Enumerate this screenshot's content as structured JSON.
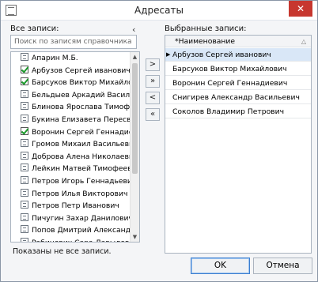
{
  "window": {
    "title": "Адресаты",
    "close_label": "✕"
  },
  "left": {
    "label": "Все записи:",
    "search_placeholder": "Поиск по записям справочника \"Работ...",
    "collapse_glyph": "‹",
    "items": [
      {
        "name": "Апарин М.Б.",
        "checked": false
      },
      {
        "name": "Арбузов Сергей иванович",
        "checked": true
      },
      {
        "name": "Барсуков Виктор Михайлович",
        "checked": true
      },
      {
        "name": "Бельдыев Аркадий Васильеви...",
        "checked": false
      },
      {
        "name": "Блинова Ярослава Тимофеев...",
        "checked": false
      },
      {
        "name": "Букина Елизавета Пересветов...",
        "checked": false
      },
      {
        "name": "Воронин Сергей Геннадиевич",
        "checked": true
      },
      {
        "name": "Громов Михаил Васильевич",
        "checked": false
      },
      {
        "name": "Доброва Алена Николаевна (...",
        "checked": false
      },
      {
        "name": "Лейкин Матвей Тимофеевич (...",
        "checked": false
      },
      {
        "name": "Петров Игорь Геннадьевич",
        "checked": false
      },
      {
        "name": "Петров Илья Викторович (МД...",
        "checked": false
      },
      {
        "name": "Петров Петр Иванович",
        "checked": false
      },
      {
        "name": "Пичугин Захар Данилович (Н...",
        "checked": false
      },
      {
        "name": "Попов Дмитрий Александров...",
        "checked": false
      },
      {
        "name": "Рабинович Сара Давыдовна (...",
        "checked": false
      },
      {
        "name": "Рябчикова Надежда Павловна...",
        "checked": false
      },
      {
        "name": "Самарин Виктор Павлович",
        "checked": false
      }
    ],
    "status": "Показаны не все записи.",
    "scroll_up": "▲",
    "scroll_down": "▼"
  },
  "move_buttons": {
    "add": ">",
    "add_all": "»",
    "remove": "<",
    "remove_all": "«"
  },
  "right": {
    "label": "Выбранные записи:",
    "column_header": "*Наименование",
    "sort_glyph": "△",
    "current_marker": "▶",
    "rows": [
      "Арбузов Сергей иванович",
      "Барсуков Виктор Михайлович",
      "Воронин Сергей Геннадиевич",
      "Снигирев Александр Васильевич",
      "Соколов Владимир Петрович"
    ]
  },
  "buttons": {
    "ok": "OK",
    "cancel": "Отмена"
  }
}
